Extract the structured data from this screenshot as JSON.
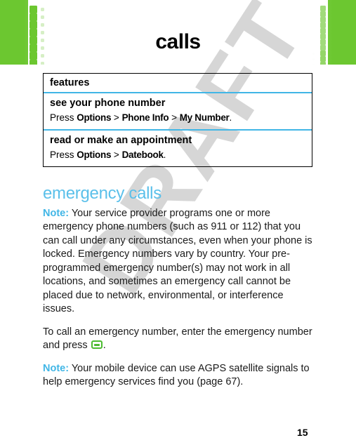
{
  "page": {
    "title": "calls",
    "number": "15",
    "watermark": "DRAFT"
  },
  "colors": {
    "banner_green": "#6cc730",
    "rule_blue": "#41b6e6",
    "heading_blue": "#5bc0ea",
    "key_icon_green": "#4cbb30",
    "watermark_gray": "#d6d6d6"
  },
  "features_table": {
    "header": "features",
    "rows": [
      {
        "title": "see your phone number",
        "instruction_prefix": "Press ",
        "steps": [
          "Options",
          "Phone Info",
          "My Number"
        ],
        "separator": " > ",
        "terminator": "."
      },
      {
        "title": "read or make an appointment",
        "instruction_prefix": "Press ",
        "steps": [
          "Options",
          "Datebook"
        ],
        "separator": " > ",
        "terminator": "."
      }
    ]
  },
  "emergency_section": {
    "heading": "emergency calls",
    "note_label_1": "Note:",
    "note_text_1": " Your service provider programs one or more emergency phone numbers (such as 911 or 112) that you can call under any circumstances, even when your phone is locked. Emergency numbers vary by country. Your pre-programmed emergency number(s) may not work in all locations, and sometimes an emergency call cannot be placed due to network, environmental, or interference issues.",
    "paragraph_2_before_icon": "To call an emergency number, enter the emergency number and press ",
    "send_key_icon_name": "send-key-icon",
    "paragraph_2_after_icon": ".",
    "note_label_2": "Note:",
    "note_text_2": " Your mobile device can use AGPS satellite signals to help emergency services find you (page 67)."
  }
}
